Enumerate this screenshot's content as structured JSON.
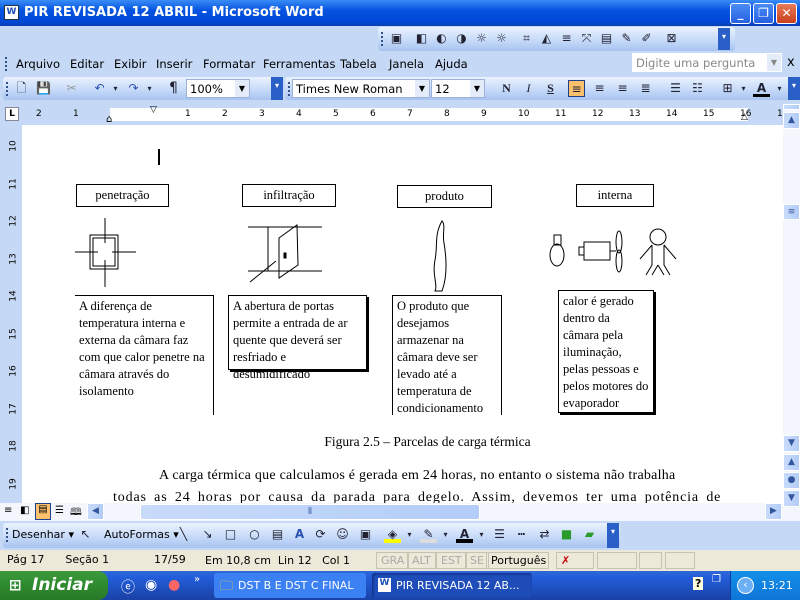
{
  "window": {
    "title": "PIR REVISADA 12 ABRIL - Microsoft Word",
    "app_icon": "W",
    "controls": [
      "minimize",
      "restore",
      "close"
    ]
  },
  "menu": {
    "items": [
      "Arquivo",
      "Editar",
      "Exibir",
      "Inserir",
      "Formatar",
      "Ferramentas",
      "Tabela",
      "Janela",
      "Ajuda"
    ],
    "help_placeholder": "Digite uma pergunta",
    "close_doc": "x"
  },
  "toolbar": {
    "zoom": "100%",
    "font": "Times New Roman",
    "size": "12",
    "bold": "N",
    "italic": "I",
    "underline": "S",
    "paragraph": "¶"
  },
  "ruler": {
    "labels": [
      "2",
      "1",
      "1",
      "2",
      "3",
      "4",
      "5",
      "6",
      "7",
      "8",
      "9",
      "10",
      "11",
      "12",
      "13",
      "14",
      "15",
      "16",
      "17"
    ],
    "vlabels": [
      "10",
      "11",
      "12",
      "13",
      "14",
      "15",
      "16",
      "17",
      "18",
      "19"
    ]
  },
  "document": {
    "figures": [
      {
        "label": "penetração",
        "text": "A diferença de temperatura interna e externa da câmara faz com que calor penetre na câmara através do isolamento"
      },
      {
        "label": "infiltração",
        "text": "A abertura de portas permite a entrada de ar quente que deverá ser resfriado e desumidificado"
      },
      {
        "label": "produto",
        "text": "O produto que desejamos armazenar na câmara deve ser levado até a temperatura de condicionamento"
      },
      {
        "label": "interna",
        "text": "calor é gerado dentro da câmara pela iluminação, pelas pessoas e pelos motores do evaporador"
      }
    ],
    "caption": "Figura 2.5 – Parcelas de carga térmica",
    "para_line1": "A carga térmica que calculamos é gerada em 24 horas, no entanto o sistema não trabalha",
    "para_line2": "todas as 24 horas por causa da parada para degelo. Assim, devemos ter uma potência de"
  },
  "drawing": {
    "draw": "Desenhar",
    "autoshapes": "AutoFormas",
    "fill_color": "#ffff00",
    "font_color": "#000000"
  },
  "status": {
    "page": "Pág 17",
    "section": "Seção 1",
    "pages": "17/59",
    "at": "Em 10,8 cm",
    "line": "Lin 12",
    "col": "Col 1",
    "rec": "GRA",
    "trk": "ALT",
    "ext": "EST",
    "ovr": "SE",
    "language": "Português ("
  },
  "taskbar": {
    "start": "Iniciar",
    "tasks": [
      "DST B E DST C FINAL",
      "PIR REVISADA 12 AB..."
    ],
    "clock": "13:21",
    "chevron": "»"
  }
}
